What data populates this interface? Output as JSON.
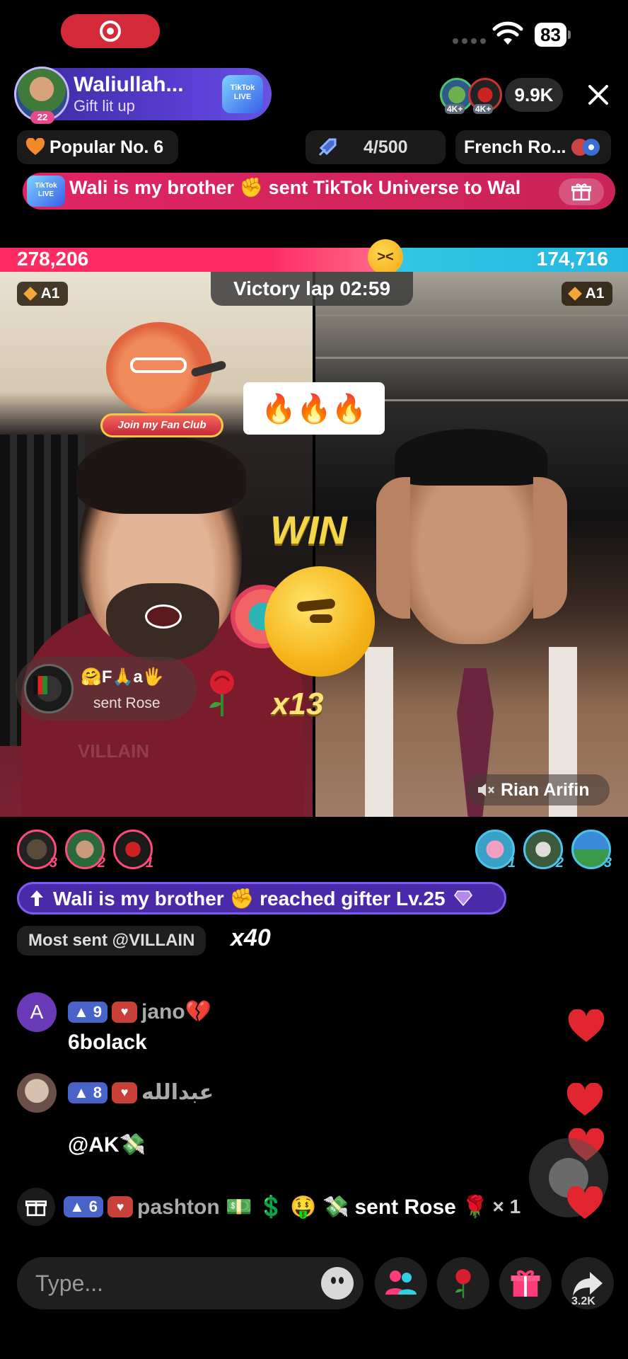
{
  "status_bar": {
    "battery": "83"
  },
  "host": {
    "name": "Waliullah...",
    "subtitle": "Gift lit up",
    "avatar_level": "22",
    "badge_label": "TikTok LIVE"
  },
  "viewers": {
    "count": "9.9K",
    "top_badges": [
      "4K+",
      "4K+"
    ]
  },
  "chips": {
    "popular": "Popular No. 6",
    "goal": "4/500",
    "music": "French Ro..."
  },
  "banner": {
    "badge_label": "TikTok LIVE",
    "text": "Wali is my brother ✊ sent TikTok Universe to Wal"
  },
  "battle": {
    "left_score": "278,206",
    "right_score": "174,716",
    "timer": "Victory lap 02:59",
    "left_rank": "A1",
    "right_rank": "A1",
    "left_share": 0.614
  },
  "overlay": {
    "fan_club": "Join my Fan Club",
    "fire": "🔥🔥🔥",
    "win": "WIN",
    "combo": "x13"
  },
  "gift_toast": {
    "name": "🤗F🙏a🖐",
    "action": "sent Rose"
  },
  "right_streamer": {
    "name": "Rian Arifin"
  },
  "left_watermark": "VILLAIN",
  "supporters": {
    "left": [
      "3",
      "2",
      "1"
    ],
    "right": [
      "1",
      "2",
      "3"
    ]
  },
  "level_banner": "Wali is my brother ✊ reached gifter Lv.25",
  "most_sent": {
    "label": "Most sent @VILLAIN",
    "combo": "x40"
  },
  "chat": [
    {
      "avatar_letter": "A",
      "level": "9",
      "user": "jano💔",
      "message": "6bolack"
    },
    {
      "level": "8",
      "user": "عبدالله",
      "message": "@AK💸"
    }
  ],
  "system_message": {
    "level": "6",
    "user": "pashton 💵 💲 🤑 💸",
    "action": "sent Rose 🌹",
    "times": "× 1"
  },
  "input": {
    "placeholder": "Type..."
  },
  "share": {
    "count": "3.2K"
  },
  "colors": {
    "red": "#fe2c63",
    "blue": "#33c7e6",
    "purple": "#4a2aa8"
  }
}
